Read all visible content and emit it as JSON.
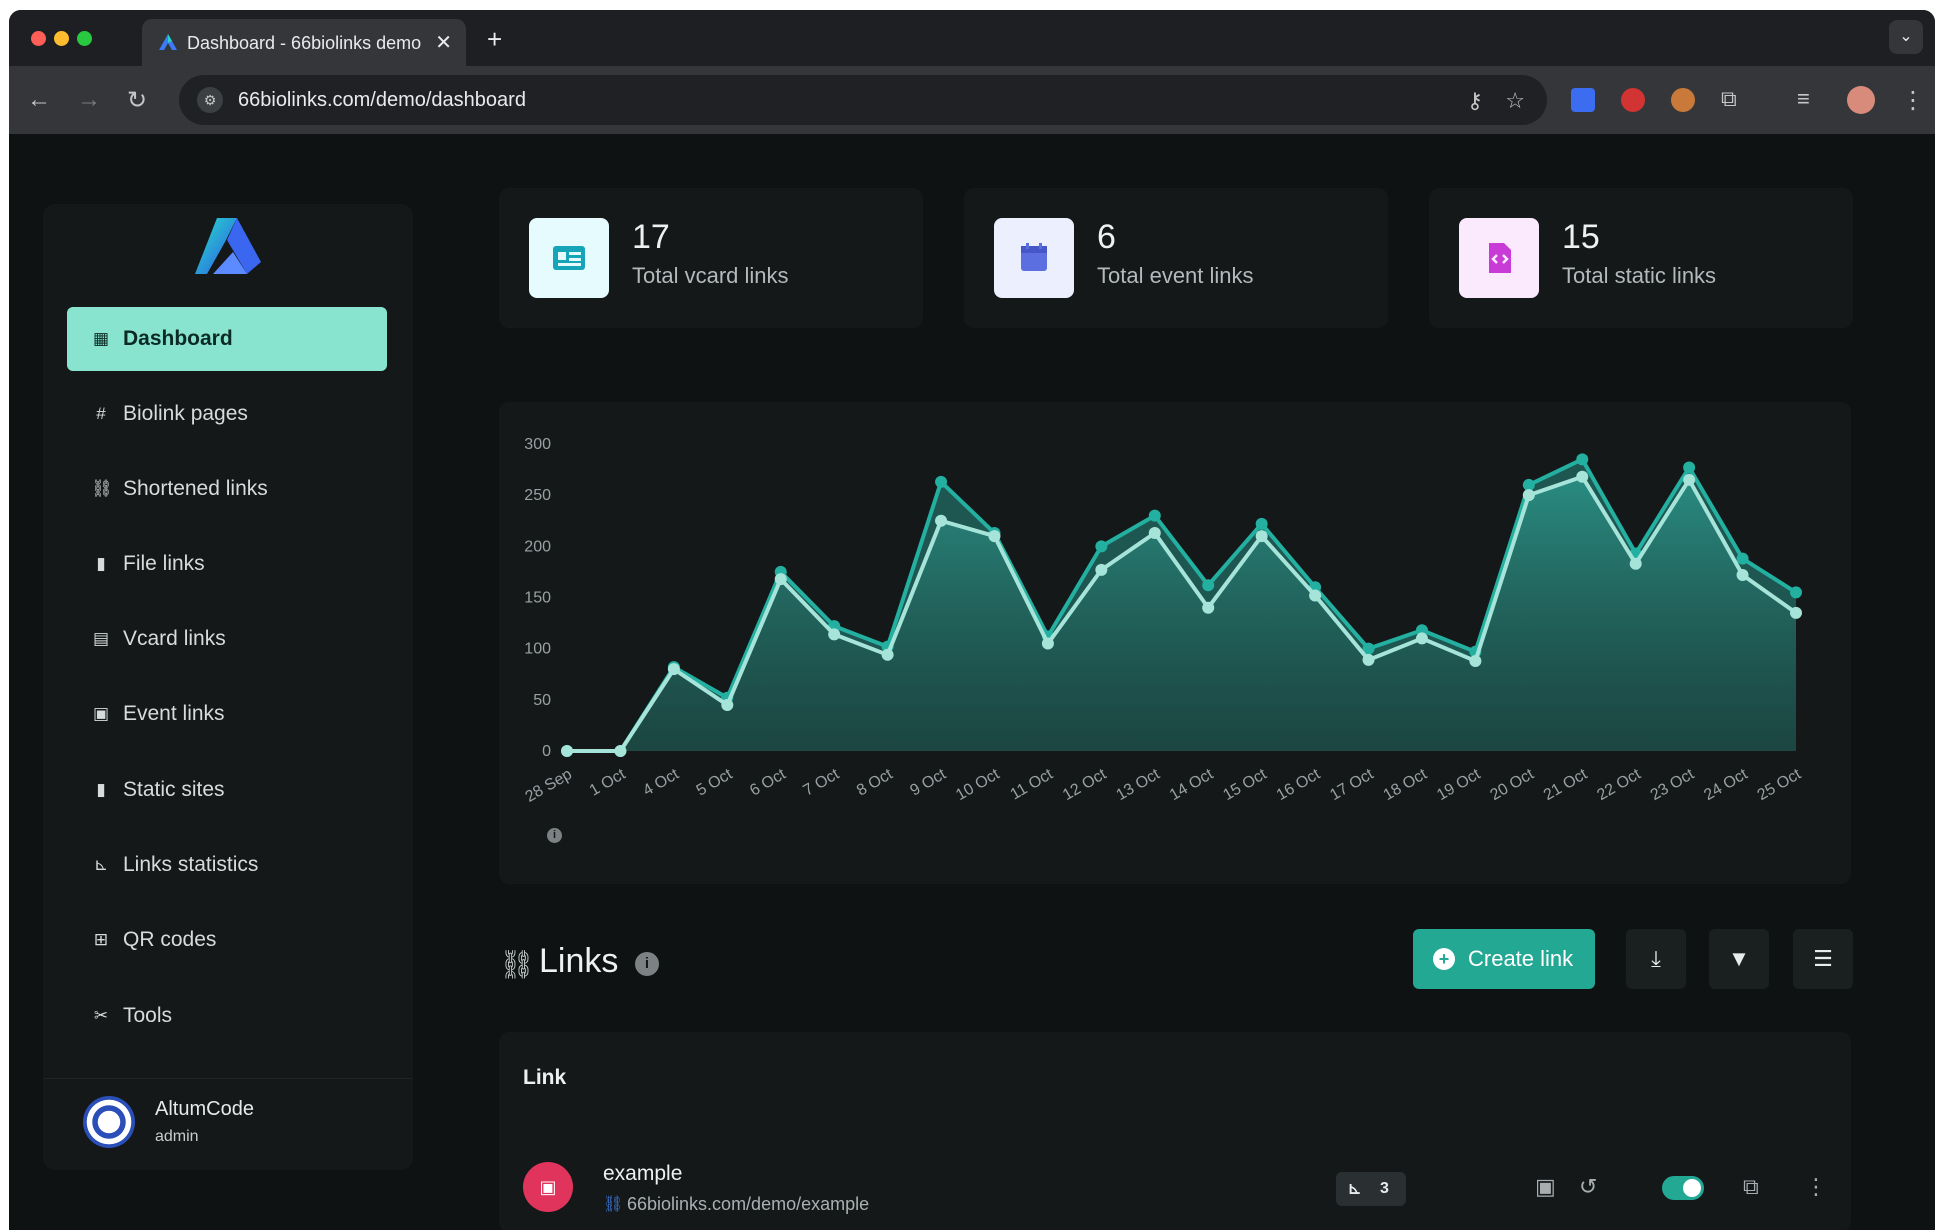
{
  "browser": {
    "tab_title": "Dashboard - 66biolinks demo",
    "url": "66biolinks.com/demo/dashboard"
  },
  "sidebar": {
    "items": [
      {
        "label": "Dashboard",
        "icon": "grid-icon"
      },
      {
        "label": "Biolink pages",
        "icon": "hash-icon"
      },
      {
        "label": "Shortened links",
        "icon": "link-icon"
      },
      {
        "label": "File links",
        "icon": "file-icon"
      },
      {
        "label": "Vcard links",
        "icon": "id-card-icon"
      },
      {
        "label": "Event links",
        "icon": "calendar-icon"
      },
      {
        "label": "Static sites",
        "icon": "file-code-icon"
      },
      {
        "label": "Links statistics",
        "icon": "chart-icon"
      },
      {
        "label": "QR codes",
        "icon": "qr-icon"
      },
      {
        "label": "Tools",
        "icon": "tools-icon"
      }
    ],
    "user": {
      "name": "AltumCode",
      "role": "admin"
    }
  },
  "stats": [
    {
      "value": "17",
      "label": "Total vcard links",
      "color": "#16a4b8"
    },
    {
      "value": "6",
      "label": "Total event links",
      "color": "#5b6fe0"
    },
    {
      "value": "15",
      "label": "Total static links",
      "color": "#c93bd6"
    }
  ],
  "chart_data": {
    "type": "area",
    "x": [
      "28 Sep",
      "1 Oct",
      "4 Oct",
      "5 Oct",
      "6 Oct",
      "7 Oct",
      "8 Oct",
      "9 Oct",
      "10 Oct",
      "11 Oct",
      "12 Oct",
      "13 Oct",
      "14 Oct",
      "15 Oct",
      "16 Oct",
      "17 Oct",
      "18 Oct",
      "19 Oct",
      "20 Oct",
      "21 Oct",
      "22 Oct",
      "23 Oct",
      "24 Oct",
      "25 Oct"
    ],
    "yticks": [
      0,
      50,
      100,
      150,
      200,
      250,
      300
    ],
    "ylim": [
      0,
      300
    ],
    "series": [
      {
        "values": [
          0,
          0,
          82,
          52,
          175,
          122,
          102,
          263,
          213,
          112,
          200,
          230,
          162,
          222,
          160,
          100,
          118,
          97,
          260,
          285,
          193,
          277,
          188,
          155
        ],
        "color": "#23b0a0"
      },
      {
        "values": [
          0,
          0,
          80,
          45,
          168,
          114,
          94,
          225,
          210,
          105,
          177,
          213,
          140,
          210,
          152,
          89,
          110,
          88,
          250,
          268,
          183,
          265,
          172,
          135
        ],
        "color": "#a6e4da"
      }
    ]
  },
  "links": {
    "title": "Links",
    "create_label": "Create link",
    "column_link": "Link",
    "rows": [
      {
        "title": "example",
        "url": "66biolinks.com/demo/example",
        "stats": "3"
      }
    ]
  }
}
